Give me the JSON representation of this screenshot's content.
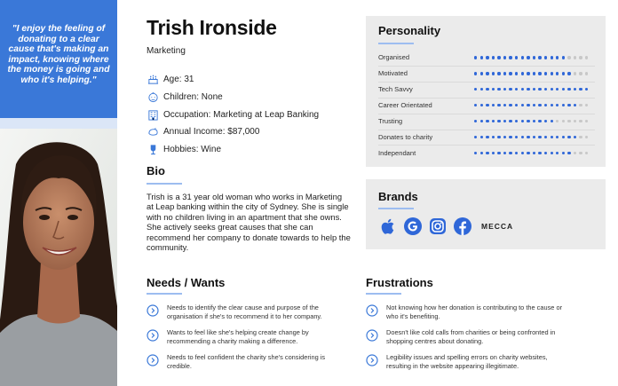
{
  "quote": "\"I enjoy the feeling of donating to a clear cause that's making an impact, knowing where the money is going and who it's helping.\"",
  "persona": {
    "name": "Trish Ironside",
    "role": "Marketing"
  },
  "facts": [
    {
      "icon": "age-icon",
      "text": "Age: 31"
    },
    {
      "icon": "children-icon",
      "text": "Children: None"
    },
    {
      "icon": "occupation-icon",
      "text": "Occupation: Marketing at Leap Banking"
    },
    {
      "icon": "income-icon",
      "text": "Annual Income: $87,000"
    },
    {
      "icon": "hobbies-icon",
      "text": "Hobbies: Wine"
    }
  ],
  "bio": {
    "title": "Bio",
    "text": "Trish is a 31 year old woman who works in Marketing at Leap banking within the city of Sydney. She is single with no children living in an apartment that she owns. She actively seeks great causes that she can recommend her company to donate towards to help the community."
  },
  "needs": {
    "title": "Needs / Wants",
    "items": [
      "Needs to identify the clear cause and purpose of the organisation if she's to recommend it to her company.",
      "Wants to feel like she's helping create change by recommending a charity making a difference.",
      "Needs to feel confident the charity she's considering is credible."
    ]
  },
  "frustrations": {
    "title": "Frustrations",
    "items": [
      "Not knowing how her donation is contributing to the cause or who it's benefiting.",
      "Doesn't like cold calls from charities or being confronted in shopping centres about donating.",
      "Legibility issues and spelling errors on charity websites, resulting in the website appearing illegitimate."
    ]
  },
  "personality": {
    "title": "Personality",
    "scale_max": 20,
    "traits": [
      {
        "label": "Organised",
        "value": 16
      },
      {
        "label": "Motivated",
        "value": 17
      },
      {
        "label": "Tech Savvy",
        "value": 20
      },
      {
        "label": "Career Orientated",
        "value": 18
      },
      {
        "label": "Trusting",
        "value": 14
      },
      {
        "label": "Donates to charity",
        "value": 18
      },
      {
        "label": "Independant",
        "value": 17
      }
    ]
  },
  "brands": {
    "title": "Brands",
    "items": [
      "apple-icon",
      "google-icon",
      "instagram-icon",
      "facebook-icon"
    ],
    "text_logo": "MECCA"
  },
  "colors": {
    "accent": "#3a78d8",
    "dot_on": "#2f67d8",
    "dot_off": "#c8c8c8",
    "panel": "#ebebeb"
  }
}
